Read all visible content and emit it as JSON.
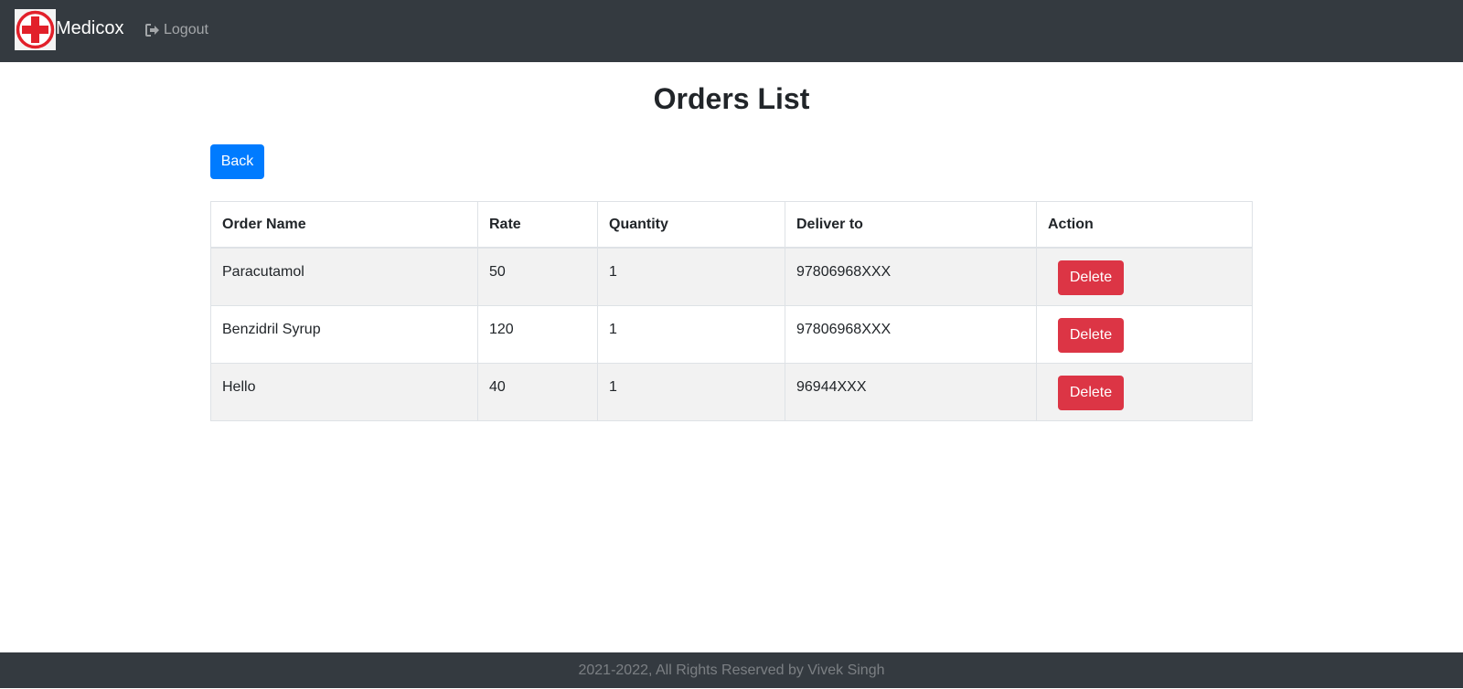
{
  "navbar": {
    "brand_name": "Medicox",
    "logo_icon": "red-cross-icon",
    "logout_label": "Logout",
    "logout_icon": "sign-out-icon"
  },
  "main": {
    "title": "Orders List",
    "back_label": "Back"
  },
  "table": {
    "headers": [
      "Order Name",
      "Rate",
      "Quantity",
      "Deliver to",
      "Action"
    ],
    "rows": [
      {
        "order_name": "Paracutamol",
        "rate": "50",
        "quantity": "1",
        "deliver_to": "97806968XXX",
        "action_label": "Delete"
      },
      {
        "order_name": "Benzidril Syrup",
        "rate": "120",
        "quantity": "1",
        "deliver_to": "97806968XXX",
        "action_label": "Delete"
      },
      {
        "order_name": "Hello",
        "rate": "40",
        "quantity": "1",
        "deliver_to": "96944XXX",
        "action_label": "Delete"
      }
    ]
  },
  "footer": {
    "text": "2021-2022, All Rights Reserved by Vivek Singh"
  },
  "colors": {
    "navbar_bg": "#343a40",
    "primary": "#007bff",
    "danger": "#dc3545",
    "striped_row": "#f2f2f2"
  }
}
